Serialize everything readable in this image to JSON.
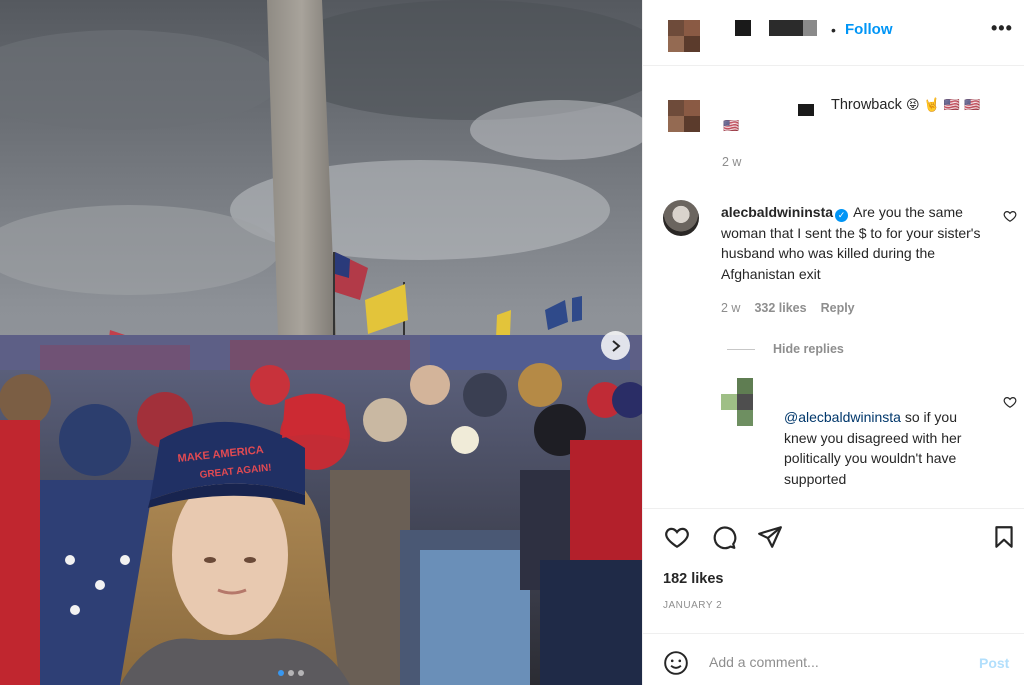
{
  "post": {
    "header": {
      "follow_separator": "•",
      "follow_label": "Follow",
      "more_label": "•••"
    },
    "caption": {
      "text": "Throwback",
      "emojis": [
        "😝",
        "🤘",
        "🇺🇸",
        "🇺🇸"
      ],
      "flag_line": "🇺🇸",
      "time": "2 w"
    },
    "comment": {
      "username": "alecbaldwininsta",
      "verified_mark": "✓",
      "text": "Are you the same woman that I sent the $ to for your sister's husband who was killed during the Afghanistan exit",
      "time": "2 w",
      "likes": "332 likes",
      "reply_label": "Reply"
    },
    "hide_replies_label": "Hide replies",
    "reply": {
      "mention": "@alecbaldwininsta",
      "text": " so if you knew you disagreed with her politically you wouldn't have supported"
    },
    "likes": "182 likes",
    "date": "JANUARY 2",
    "add_comment": {
      "placeholder": "Add a comment...",
      "post_label": "Post"
    }
  },
  "photo": {
    "carousel_dots": 3,
    "active_dot": 0,
    "hat_text": "MAKE AMERICA GREAT AGAIN!",
    "sign_text": "MAKE AMERICA GREAT AGAIN"
  },
  "colors": {
    "accent": "#0095f6",
    "text": "#262626",
    "muted": "#8e8e8e",
    "link": "#00376b"
  }
}
